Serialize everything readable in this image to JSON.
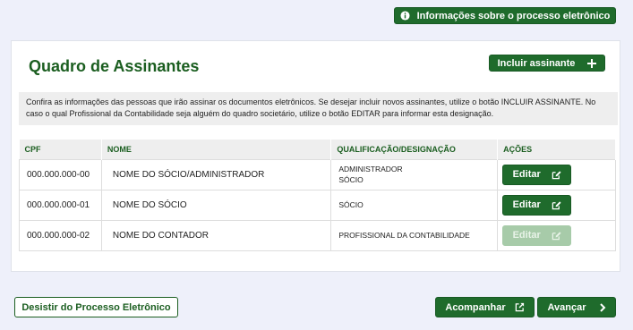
{
  "header": {
    "info_button_label": "Informações sobre o processo eletrônico"
  },
  "card": {
    "title": "Quadro de Assinantes",
    "add_button_label": "Incluir assinante",
    "info_text": "Confira as informações das pessoas que irão assinar os documentos eletrônicos. Se desejar incluir novos assinantes, utilize o botão INCLUIR ASSINANTE. No caso o qual Profissional da Contabilidade seja alguém do quadro societário, utilize o botão EDITAR para informar esta designação."
  },
  "table": {
    "columns": [
      "CPF",
      "NOME",
      "QUALIFICAÇÃO/DESIGNAÇÃO",
      "AÇÕES"
    ],
    "rows": [
      {
        "cpf": "000.000.000-00",
        "nome": "NOME DO SÓCIO/ADMINISTRADOR",
        "qual_line1": "ADMINISTRADOR",
        "qual_line2": "SÓCIO",
        "action": "Editar",
        "enabled": true
      },
      {
        "cpf": "000.000.000-01",
        "nome": "NOME DO SÓCIO",
        "qual_line1": "SÓCIO",
        "qual_line2": "",
        "action": "Editar",
        "enabled": true
      },
      {
        "cpf": "000.000.000-02",
        "nome": "NOME DO CONTADOR",
        "qual_line1": "PROFISSIONAL DA CONTABILIDADE",
        "qual_line2": "",
        "action": "Editar",
        "enabled": false
      }
    ]
  },
  "footer": {
    "desist_label": "Desistir do Processo Eletrônico",
    "track_label": "Acompanhar",
    "next_label": "Avançar"
  },
  "colors": {
    "primary": "#1f6b2c",
    "title": "#1b5e20",
    "disabled": "#a7cba9",
    "background": "#eef0fa"
  },
  "icons": [
    "info-circle-icon",
    "plus-icon",
    "edit-icon",
    "external-link-icon",
    "chevron-right-icon"
  ]
}
